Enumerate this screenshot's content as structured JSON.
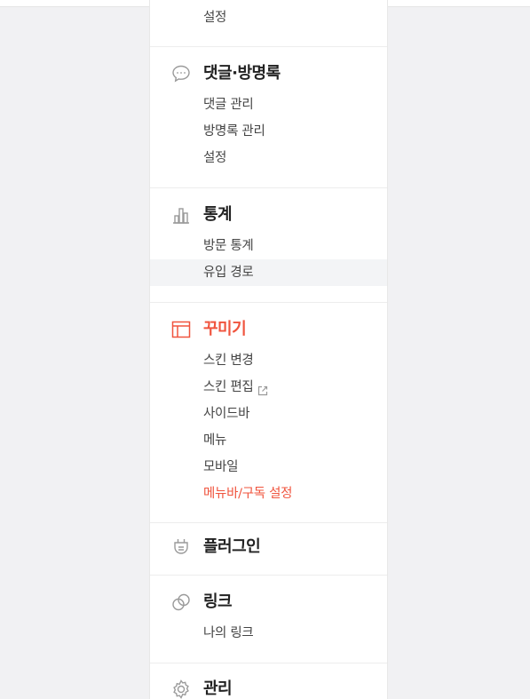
{
  "sections": {
    "top": {
      "items": [
        {
          "label": "설정"
        }
      ]
    },
    "comments": {
      "title": "댓글·방명록",
      "icon": "speech-bubble-icon",
      "items": [
        {
          "label": "댓글 관리"
        },
        {
          "label": "방명록 관리"
        },
        {
          "label": "설정"
        }
      ]
    },
    "stats": {
      "title": "통계",
      "icon": "bar-chart-icon",
      "items": [
        {
          "label": "방문 통계"
        },
        {
          "label": "유입 경로"
        }
      ]
    },
    "design": {
      "title": "꾸미기",
      "icon": "layout-icon",
      "items": [
        {
          "label": "스킨 변경"
        },
        {
          "label": "스킨 편집"
        },
        {
          "label": "사이드바"
        },
        {
          "label": "메뉴"
        },
        {
          "label": "모바일"
        },
        {
          "label": "메뉴바/구독 설정"
        }
      ]
    },
    "plugin": {
      "title": "플러그인",
      "icon": "plug-icon"
    },
    "link": {
      "title": "링크",
      "icon": "chain-link-icon",
      "items": [
        {
          "label": "나의 링크"
        }
      ]
    },
    "manage": {
      "title": "관리",
      "icon": "gear-icon"
    }
  },
  "colors": {
    "accent": "#f0543e",
    "text": "#222222",
    "subtext": "#444444",
    "highlight": "#f3f4f6"
  }
}
